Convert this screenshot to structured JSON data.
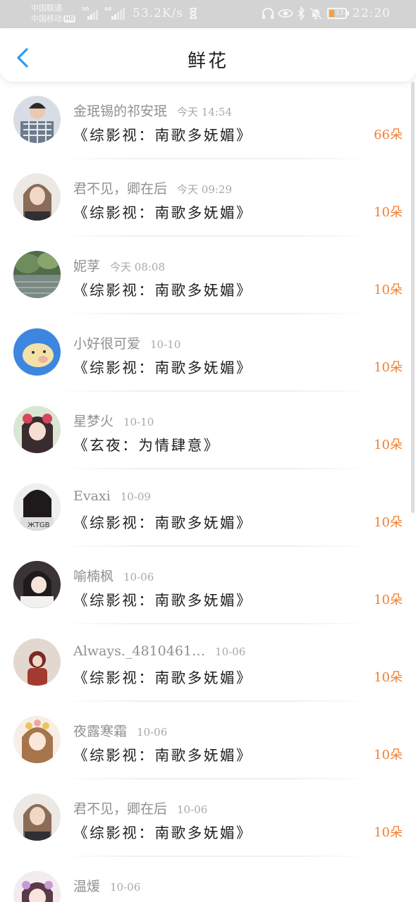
{
  "status_bar": {
    "carrier_1": "中国联通",
    "carrier_2": "中国移动",
    "hd_badge": "HD",
    "signal_1_tag": "3G",
    "signal_2_tag": "4G",
    "network_speed": "53.2K/s",
    "battery_level": "17",
    "battery_color": "#f2a241",
    "time": "22:20",
    "icons": [
      "hourglass-icon",
      "headphones-icon",
      "eye-icon",
      "bluetooth-icon",
      "mute-icon",
      "battery-icon"
    ]
  },
  "header": {
    "title": "鲜花",
    "back_icon": "chevron-left-icon",
    "accent_color": "#2b9af3"
  },
  "list": {
    "count_color": "#f27e2e",
    "items": [
      {
        "user": "金珉锡的祁安珉",
        "time": "今天 14:54",
        "book": "《综影视：南歌多妩媚》",
        "count": "66朵"
      },
      {
        "user": "君不见，卿在后",
        "time": "今天 09:29",
        "book": "《综影视：南歌多妩媚》",
        "count": "10朵"
      },
      {
        "user": "妮莩",
        "time": "今天 08:08",
        "book": "《综影视：南歌多妩媚》",
        "count": "10朵"
      },
      {
        "user": "小好很可爱",
        "time": "10-10",
        "book": "《综影视：南歌多妩媚》",
        "count": "10朵"
      },
      {
        "user": "星梦火",
        "time": "10-10",
        "book": "《玄夜：为情肆意》",
        "count": "10朵"
      },
      {
        "user": "Evaxi",
        "time": "10-09",
        "book": "《综影视：南歌多妩媚》",
        "count": "10朵"
      },
      {
        "user": "喻楠枫",
        "time": "10-06",
        "book": "《综影视：南歌多妩媚》",
        "count": "10朵"
      },
      {
        "user": "Always._4810461…",
        "time": "10-06",
        "book": "《综影视：南歌多妩媚》",
        "count": "10朵"
      },
      {
        "user": "夜露寒霜",
        "time": "10-06",
        "book": "《综影视：南歌多妩媚》",
        "count": "10朵"
      },
      {
        "user": "君不见，卿在后",
        "time": "10-06",
        "book": "《综影视：南歌多妩媚》",
        "count": "10朵"
      },
      {
        "user": "温煖",
        "time": "10-06",
        "book": "",
        "count": ""
      }
    ]
  }
}
